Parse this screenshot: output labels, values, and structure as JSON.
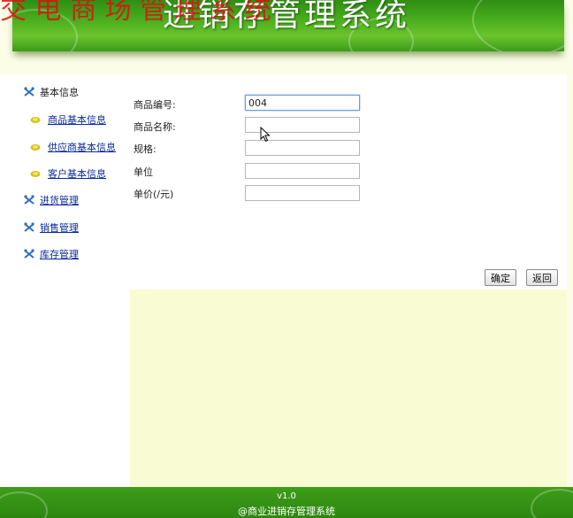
{
  "banner": {
    "title": "进销存管理系统",
    "watermark": "交  电  商  场  管  理  系  统"
  },
  "sidebar": {
    "basic_info": "基本信息",
    "sub_items": [
      "商品基本信息",
      "供应商基本信息",
      "客户基本信息"
    ],
    "purchase": "进货管理",
    "sales": "销售管理",
    "inventory": "库存管理"
  },
  "form": {
    "code_label": "商品编号:",
    "code_value": "004",
    "name_label": "商品名称:",
    "name_value": "",
    "spec_label": "规格:",
    "spec_value": "",
    "unit_label": "单位",
    "unit_value": "",
    "price_label": "单价(/元)",
    "price_value": ""
  },
  "buttons": {
    "confirm": "确定",
    "back": "返回"
  },
  "footer": {
    "version": "v1.0",
    "copyright": "@商业进销存管理系统"
  },
  "colors": {
    "banner_green": "#4fb320",
    "link_blue": "#0a2a9a",
    "content_bg": "#f9fcd2"
  }
}
